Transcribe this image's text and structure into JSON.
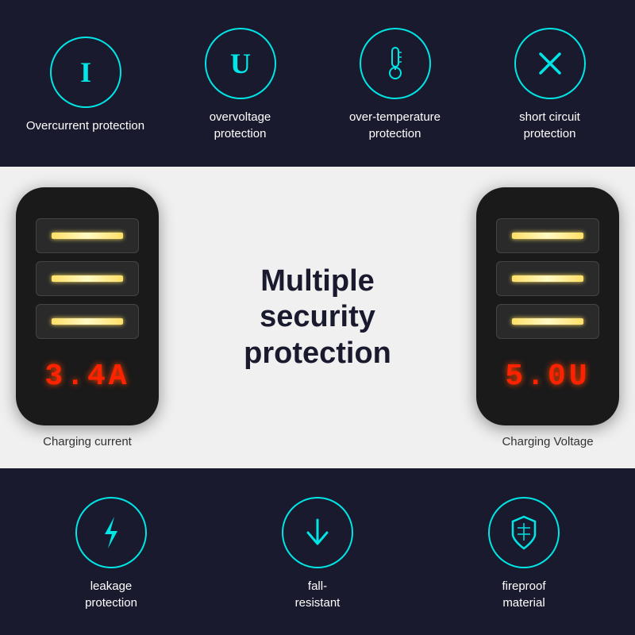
{
  "top": {
    "features": [
      {
        "id": "overcurrent",
        "icon": "I",
        "label": "Overcurrent\nprotection",
        "iconType": "letter"
      },
      {
        "id": "overvoltage",
        "icon": "U",
        "label": "overvoltage\nprotection",
        "iconType": "letter"
      },
      {
        "id": "over-temperature",
        "icon": "thermometer",
        "label": "over-temperature\nprotection",
        "iconType": "thermometer"
      },
      {
        "id": "short-circuit",
        "icon": "X",
        "label": "short circuit\nprotection",
        "iconType": "letter"
      }
    ]
  },
  "middle": {
    "left_device": {
      "readout": "3.4A",
      "label": "Charging current"
    },
    "right_device": {
      "readout": "5.0U",
      "label": "Charging Voltage"
    },
    "center_text": "Multiple\nsecurity\nprotection"
  },
  "bottom": {
    "features": [
      {
        "id": "leakage",
        "icon": "lightning",
        "label": "leakage\nprotection",
        "iconType": "lightning"
      },
      {
        "id": "fall-resistant",
        "icon": "arrow-down",
        "label": "fall-\nresistant",
        "iconType": "arrow"
      },
      {
        "id": "fireproof",
        "icon": "shield",
        "label": "fireproof\nmaterial",
        "iconType": "shield"
      }
    ]
  },
  "colors": {
    "accent": "#00e5e5",
    "dark_bg": "#1a1a2e",
    "white": "#ffffff",
    "red_display": "#ff2200"
  }
}
